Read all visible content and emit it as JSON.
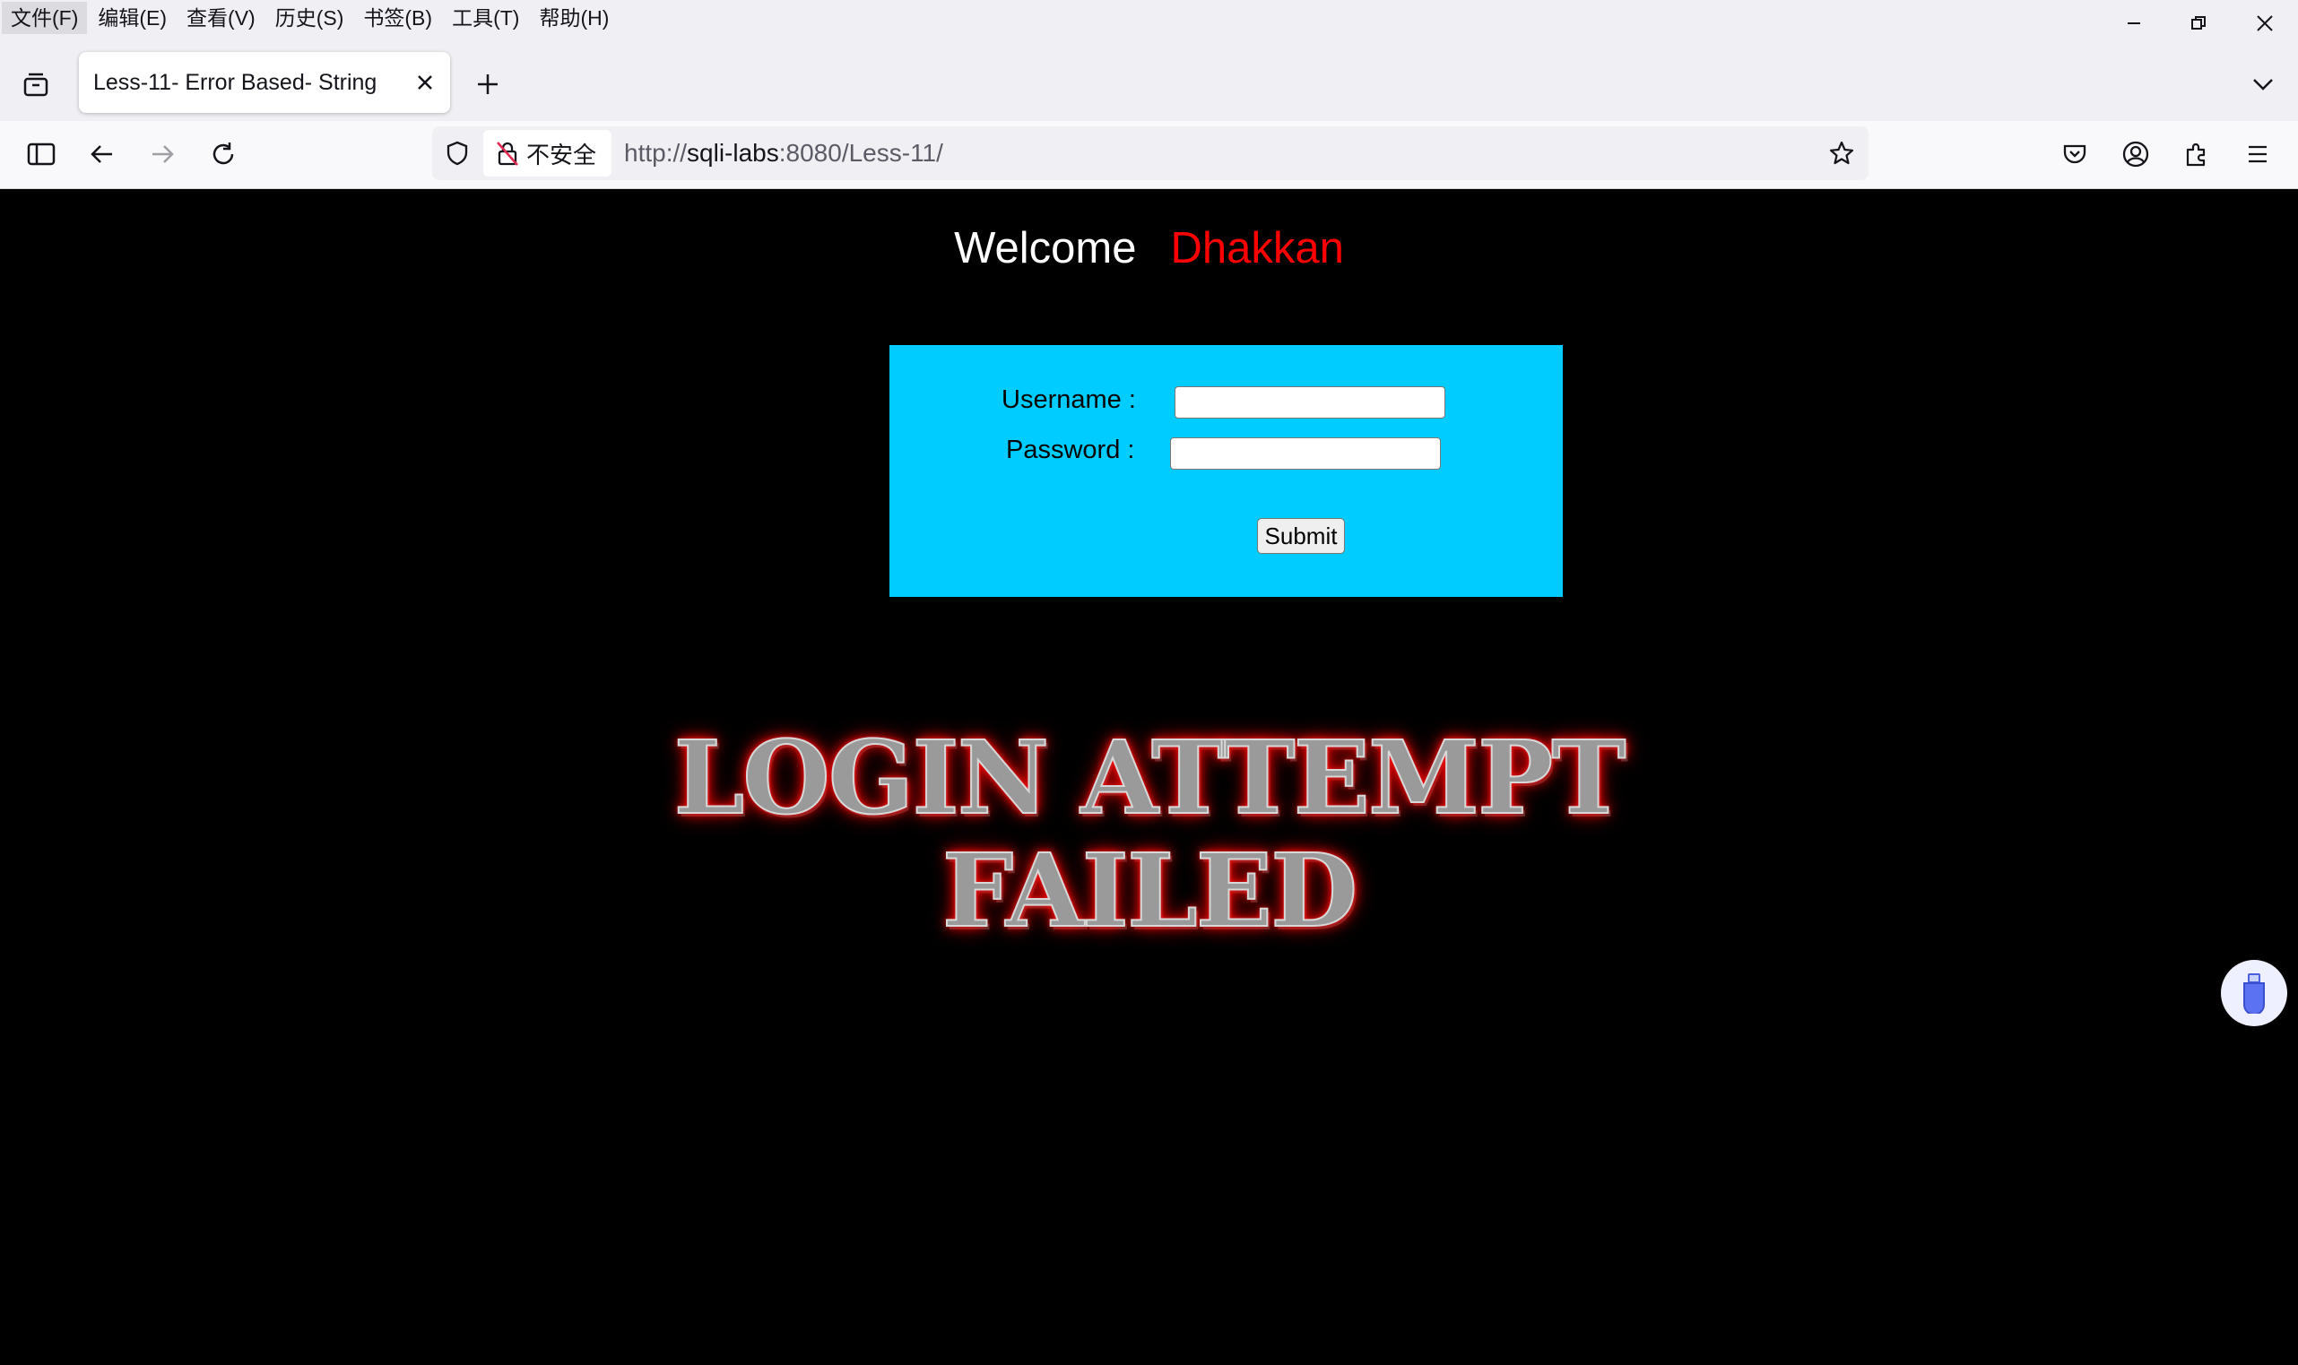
{
  "menu": {
    "items": [
      "文件(F)",
      "编辑(E)",
      "查看(V)",
      "历史(S)",
      "书签(B)",
      "工具(T)",
      "帮助(H)"
    ]
  },
  "tab": {
    "title": "Less-11- Error Based- String"
  },
  "navbar": {
    "security_label": "不安全",
    "url_scheme": "http://",
    "url_host": "sqli-labs",
    "url_rest": ":8080/Less-11/"
  },
  "page": {
    "welcome": "Welcome",
    "user_name": "Dhakkan",
    "username_label": "Username :",
    "password_label": "Password :",
    "username_value": "",
    "password_value": "",
    "submit_label": "Submit",
    "banner_line1": "LOGIN ATTEMPT",
    "banner_line2": "FAILED"
  },
  "colors": {
    "page_background": "#000000",
    "login_box": "#00ccff",
    "user_name": "#ff0000",
    "banner_glow": "#ff0000"
  }
}
